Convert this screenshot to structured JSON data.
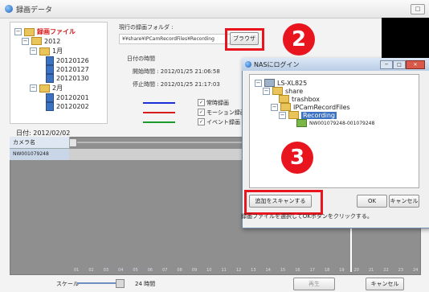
{
  "window": {
    "title": "録画データ",
    "close_label": "□"
  },
  "tree": {
    "root": "録画ファイル",
    "year": "2012",
    "months": [
      {
        "label": "1月",
        "days": [
          "20120126",
          "20120127",
          "20120130"
        ]
      },
      {
        "label": "2月",
        "days": [
          "20120201",
          "20120202"
        ]
      }
    ]
  },
  "info": {
    "folder_label": "現行の録画フォルダ :",
    "folder_path": "¥¥share¥IPCamRecordFiles¥Recording",
    "browse_label": "ブラウザ",
    "time_header": "日付の時間",
    "start_label": "開始時間 : 2012/01/25 21:06:58",
    "end_label": "停止時間 : 2012/01/25 21:17:03"
  },
  "legend": [
    {
      "label": "常時録画",
      "color": "#1b2fd8",
      "checked": "✓"
    },
    {
      "label": "モーション録画",
      "color": "#d81b1b",
      "checked": "✓"
    },
    {
      "label": "イベント録画",
      "color": "#1c9b2d",
      "checked": "✓"
    }
  ],
  "timeline": {
    "date_label": "日付:   2012/02/02",
    "camera_header": "カメラ名",
    "camera_id": "NW001079248",
    "ticks": [
      "01",
      "02",
      "03",
      "04",
      "05",
      "06",
      "07",
      "08",
      "09",
      "10",
      "11",
      "12",
      "13",
      "14",
      "15",
      "16",
      "17",
      "18",
      "19",
      "20",
      "21",
      "22",
      "23",
      "24"
    ]
  },
  "scale": {
    "label": "スケール",
    "value": "24 時間"
  },
  "buttons": {
    "play": "再生",
    "cancel": "キャンセル"
  },
  "dialog": {
    "title": "NASにログイン",
    "nodes": [
      "LS-XL825",
      "share",
      "trashbox",
      "IPCamRecordFiles",
      "Recording",
      "NW001079248-001079248"
    ],
    "scan_label": "追加をスキャンする",
    "ok_label": "OK",
    "cancel_label": "キャンセル",
    "min_label": "─",
    "max_label": "□",
    "close_label": "✕"
  },
  "status": {
    "text": "録画ファイルを選択してOKボタンをクリックする。"
  },
  "badges": {
    "step2": "2",
    "step3": "3"
  }
}
